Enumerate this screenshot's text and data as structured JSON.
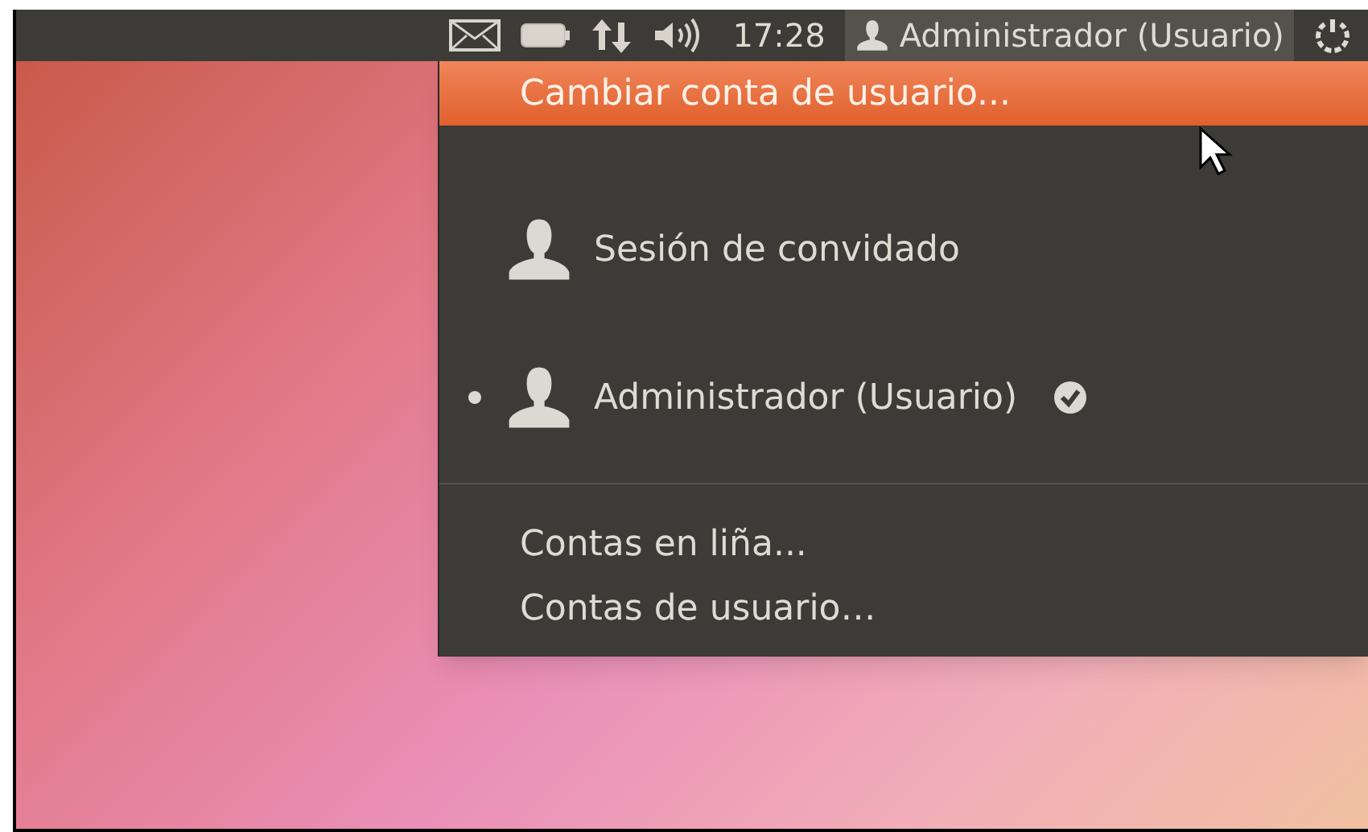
{
  "panel": {
    "indicators": [
      {
        "kind": "mail"
      },
      {
        "kind": "battery"
      },
      {
        "kind": "network"
      },
      {
        "kind": "sound"
      }
    ],
    "clock": "17:28",
    "user": {
      "name": "Administrador (Usuario)",
      "selected": true
    }
  },
  "menu": {
    "items": [
      {
        "kind": "action",
        "label": "Cambiar conta de usuario...",
        "highlighted": true
      },
      {
        "kind": "user",
        "label": "Sesión de convidado",
        "selected": false,
        "checked": false
      },
      {
        "kind": "user",
        "label": "Administrador (Usuario)",
        "selected": true,
        "checked": true
      },
      {
        "kind": "separator"
      },
      {
        "kind": "action",
        "label": "Contas en liña...",
        "highlighted": false
      },
      {
        "kind": "action",
        "label": "Contas de usuario…",
        "highlighted": false
      }
    ]
  }
}
